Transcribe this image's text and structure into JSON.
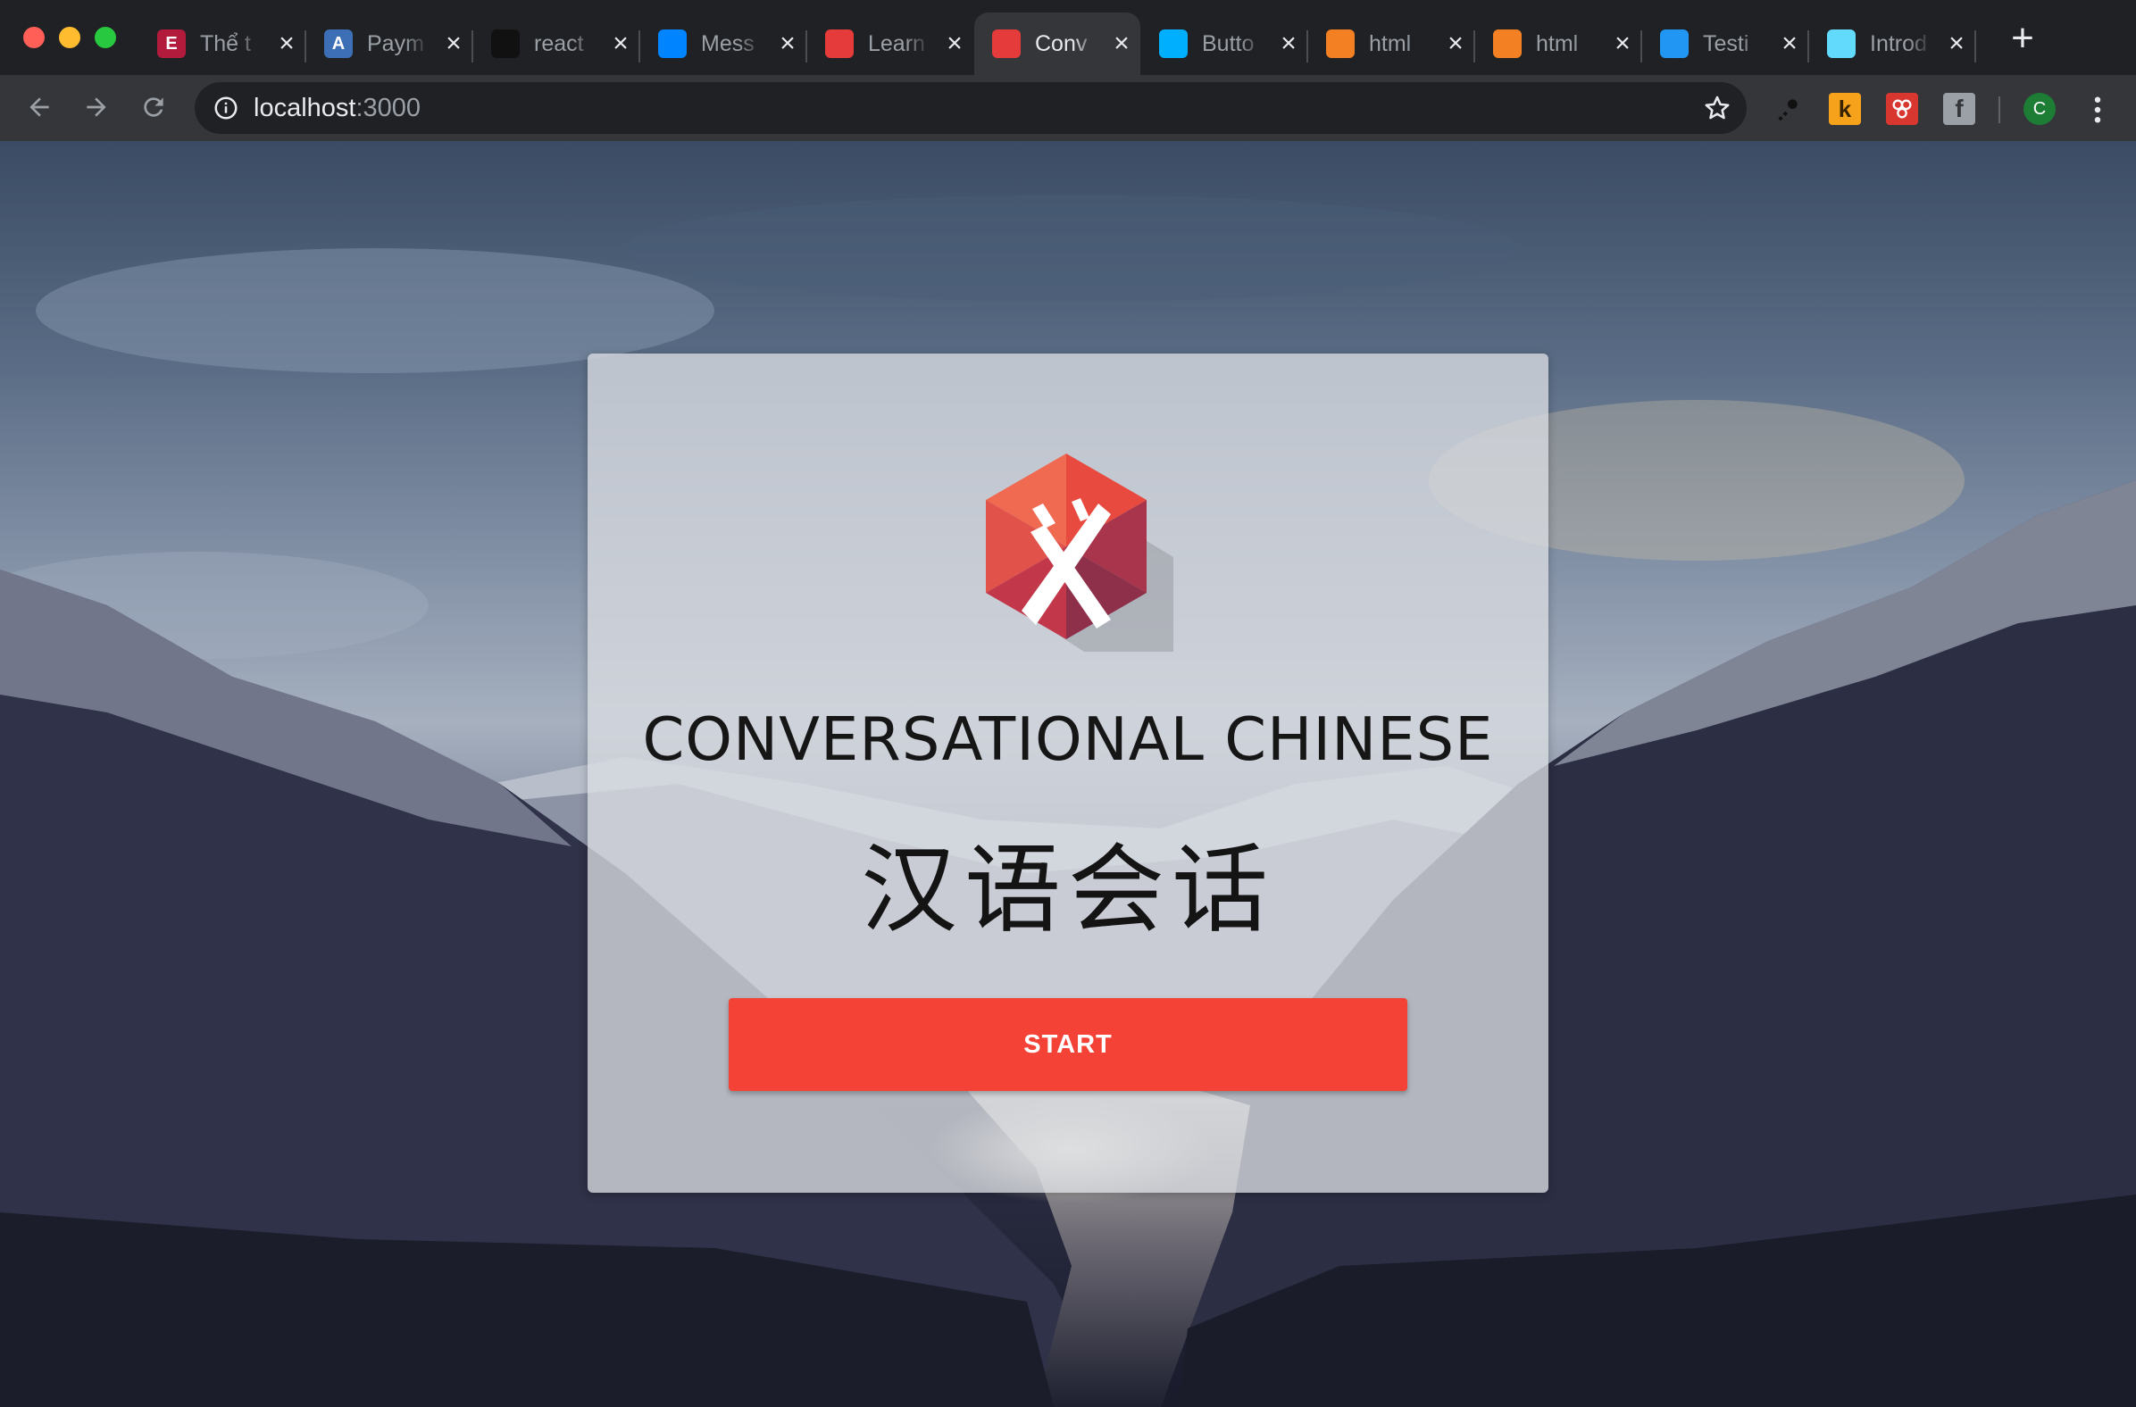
{
  "browser": {
    "tabs": [
      {
        "title": "Thể t",
        "icon": "edx-icon",
        "color": "#b31b3d",
        "glyph": "E"
      },
      {
        "title": "Paym",
        "icon": "app-store-connect-icon",
        "color": "#3d6fb7",
        "glyph": "A"
      },
      {
        "title": "react",
        "icon": "github-icon",
        "color": "#111111",
        "glyph": ""
      },
      {
        "title": "Mess",
        "icon": "messenger-icon",
        "color": "#0084ff",
        "glyph": ""
      },
      {
        "title": "Learn",
        "icon": "app-logo-icon",
        "color": "#e63b3b",
        "glyph": ""
      },
      {
        "title": "Conv",
        "icon": "app-logo-icon",
        "color": "#e63b3b",
        "glyph": "",
        "active": true
      },
      {
        "title": "Butto",
        "icon": "material-ui-icon",
        "color": "#00b0ff",
        "glyph": ""
      },
      {
        "title": "html",
        "icon": "stackoverflow-icon",
        "color": "#f48024",
        "glyph": ""
      },
      {
        "title": "html",
        "icon": "stackoverflow-icon",
        "color": "#f48024",
        "glyph": ""
      },
      {
        "title": "Testi",
        "icon": "book-icon",
        "color": "#2196f3",
        "glyph": ""
      },
      {
        "title": "Introd",
        "icon": "react-icon",
        "color": "#61dafb",
        "glyph": ""
      }
    ],
    "close_glyph": "×",
    "new_tab_glyph": "+",
    "url_host": "localhost",
    "url_port": ":3000",
    "avatar_letter": "C"
  },
  "page": {
    "title_en": "CONVERSATIONAL CHINESE",
    "title_zh": "汉语会话",
    "start_label": "START",
    "accent_color": "#f44336"
  }
}
